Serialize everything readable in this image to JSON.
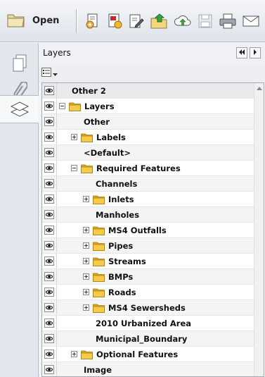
{
  "toolbar": {
    "open_label": "Open",
    "icons": [
      "open-folder-icon",
      "attach-file-icon",
      "create-pdf-icon",
      "edit-icon",
      "upload-folder-icon",
      "cloud-upload-icon",
      "save-icon",
      "print-icon",
      "email-icon"
    ]
  },
  "nav": {
    "items": [
      "pages-icon",
      "attachments-icon",
      "layers-icon"
    ],
    "active": "layers-icon"
  },
  "panel": {
    "title": "Layers"
  },
  "layers": [
    {
      "label": "Other 2",
      "level": 0,
      "expander": "none",
      "folder": false
    },
    {
      "label": "Layers",
      "level": 0,
      "expander": "minus",
      "folder": true
    },
    {
      "label": "Other",
      "level": 1,
      "expander": "none",
      "folder": false
    },
    {
      "label": "Labels",
      "level": 1,
      "expander": "plus",
      "folder": true
    },
    {
      "label": "<Default>",
      "level": 1,
      "expander": "none",
      "folder": false
    },
    {
      "label": "Required Features",
      "level": 1,
      "expander": "minus",
      "folder": true
    },
    {
      "label": "Channels",
      "level": 2,
      "expander": "none",
      "folder": false
    },
    {
      "label": "Inlets",
      "level": 2,
      "expander": "plus",
      "folder": true
    },
    {
      "label": "Manholes",
      "level": 2,
      "expander": "none",
      "folder": false
    },
    {
      "label": "MS4 Outfalls",
      "level": 2,
      "expander": "plus",
      "folder": true
    },
    {
      "label": "Pipes",
      "level": 2,
      "expander": "plus",
      "folder": true
    },
    {
      "label": "Streams",
      "level": 2,
      "expander": "plus",
      "folder": true
    },
    {
      "label": "BMPs",
      "level": 2,
      "expander": "plus",
      "folder": true
    },
    {
      "label": "Roads",
      "level": 2,
      "expander": "plus",
      "folder": true
    },
    {
      "label": "MS4 Sewersheds",
      "level": 2,
      "expander": "plus",
      "folder": true
    },
    {
      "label": "2010 Urbanized Area",
      "level": 2,
      "expander": "none",
      "folder": false
    },
    {
      "label": "Municipal_Boundary",
      "level": 2,
      "expander": "none",
      "folder": false
    },
    {
      "label": "Optional Features",
      "level": 1,
      "expander": "plus",
      "folder": true
    },
    {
      "label": "Image",
      "level": 1,
      "expander": "none",
      "folder": false
    }
  ],
  "colors": {
    "folder": "#f5c94a",
    "folder_dark": "#d9a41e",
    "accent": "#2f7d3a"
  }
}
